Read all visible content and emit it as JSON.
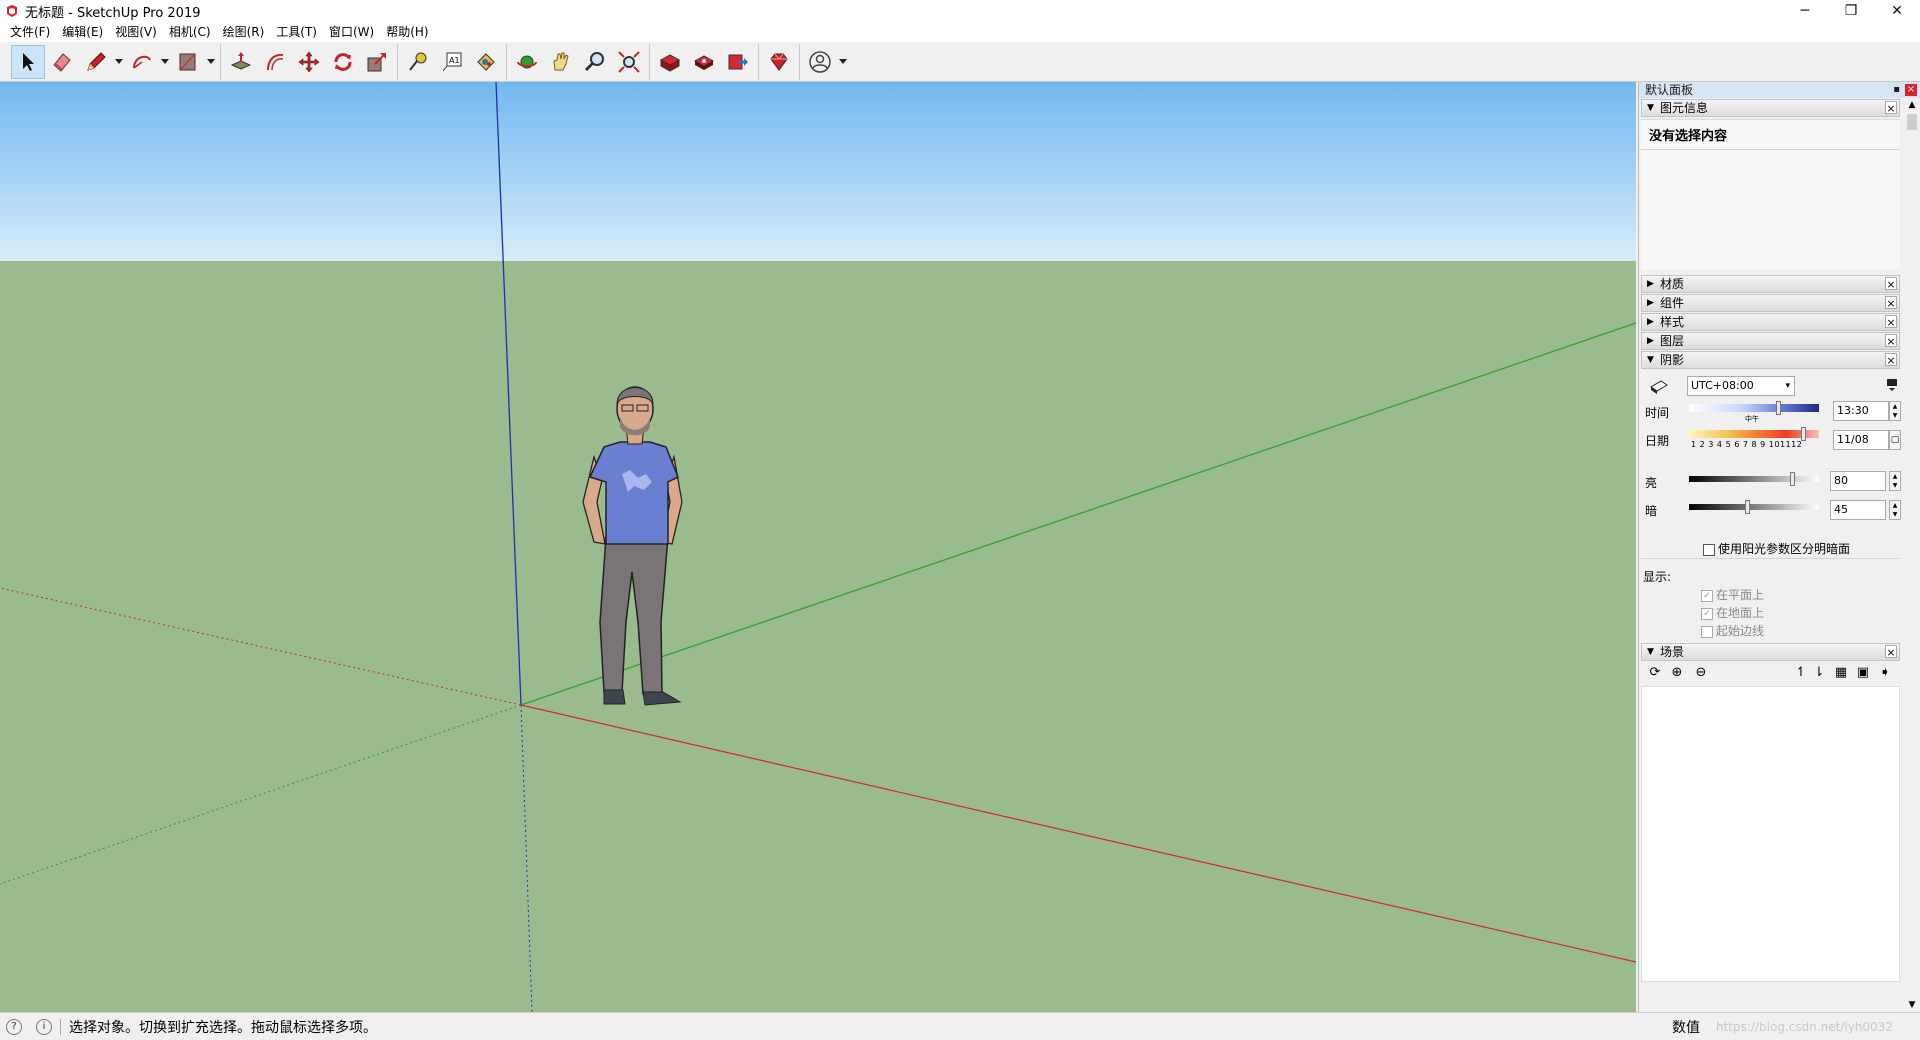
{
  "window": {
    "title": "无标题 - SketchUp Pro 2019",
    "controls": [
      "─",
      "❐",
      "✕"
    ]
  },
  "menu": [
    "文件(F)",
    "编辑(E)",
    "视图(V)",
    "相机(C)",
    "绘图(R)",
    "工具(T)",
    "窗口(W)",
    "帮助(H)"
  ],
  "toolbar": {
    "tools": [
      "select-icon",
      "eraser-icon",
      "pencil-icon",
      "arc-icon",
      "rectangle-icon",
      "push-pull-icon",
      "offset-icon",
      "move-icon",
      "rotate-icon",
      "scale-icon",
      "tape-measure-icon",
      "text-icon",
      "paint-bucket-icon",
      "orbit-icon",
      "pan-icon",
      "zoom-icon",
      "zoom-extents-icon",
      "warehouse-icon",
      "extension-warehouse-icon",
      "send-to-layout-icon",
      "ruby-console-icon",
      "account-icon"
    ]
  },
  "viewport": {
    "sky_color": "#aad4f5",
    "ground_color": "#9abb8e",
    "axis_red": "#cc2a2a",
    "axis_green": "#2ca02c",
    "axis_blue": "#1f2fb0"
  },
  "tray": {
    "title": "默认面板",
    "pin": "📌",
    "close": "×",
    "entity_info": {
      "label": "图元信息",
      "empty_text": "没有选择内容"
    },
    "panels": [
      "材质",
      "组件",
      "样式",
      "图层"
    ],
    "shadows": {
      "label": "阴影",
      "timezone": "UTC+08:00",
      "time_label": "时间",
      "time_value": "13:30",
      "time_marker": "中午",
      "date_label": "日期",
      "date_value": "11/08",
      "months": [
        "1",
        "2",
        "3",
        "4",
        "5",
        "6",
        "7",
        "8",
        "9",
        "10",
        "11",
        "12"
      ],
      "light_label": "亮",
      "light_value": "80",
      "dark_label": "暗",
      "dark_value": "45",
      "use_sun_label": "使用阳光参数区分明暗面",
      "display_label": "显示:",
      "on_faces": "在平面上",
      "on_ground": "在地面上",
      "from_edges": "起始边线",
      "light_level": 0.8,
      "dark_level": 0.45
    },
    "scenes": {
      "label": "场景"
    }
  },
  "status": {
    "message": "选择对象。切换到扩充选择。拖动鼠标选择多项。",
    "measurements_label": "数值",
    "watermark": "https://blog.csdn.net/lyh0032"
  }
}
